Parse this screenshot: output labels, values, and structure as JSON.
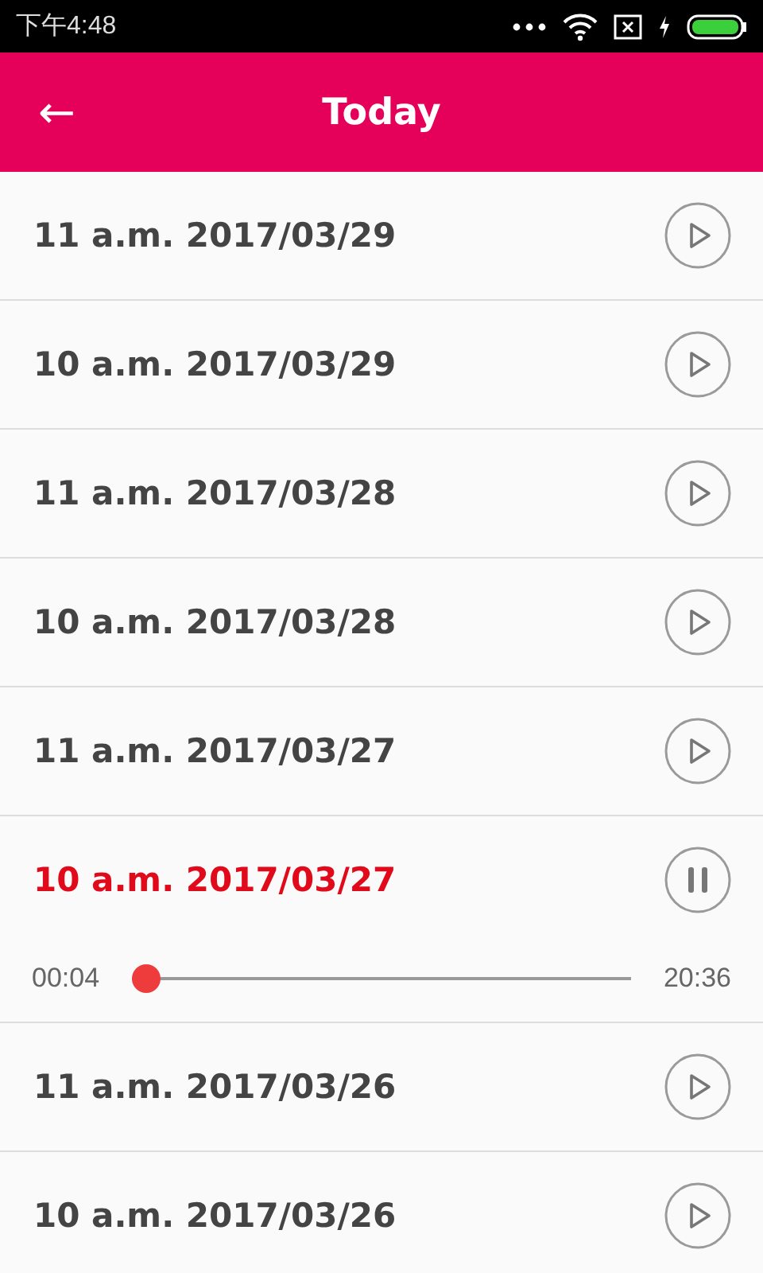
{
  "status_bar": {
    "time": "下午4:48"
  },
  "app_bar": {
    "back": "←",
    "title": "Today"
  },
  "recordings": [
    {
      "title": "11 a.m. 2017/03/29",
      "selected": false
    },
    {
      "title": "10 a.m. 2017/03/29",
      "selected": false
    },
    {
      "title": "11 a.m. 2017/03/28",
      "selected": false
    },
    {
      "title": "10 a.m. 2017/03/28",
      "selected": false
    },
    {
      "title": "11 a.m. 2017/03/27",
      "selected": false
    },
    {
      "title": "10 a.m. 2017/03/27",
      "selected": true,
      "player": {
        "elapsed": "00:04",
        "duration": "20:36",
        "level": 0.003
      }
    },
    {
      "title": "11 a.m. 2017/03/26",
      "selected": false
    },
    {
      "title": "10 a.m. 2017/03/26",
      "selected": false
    }
  ]
}
